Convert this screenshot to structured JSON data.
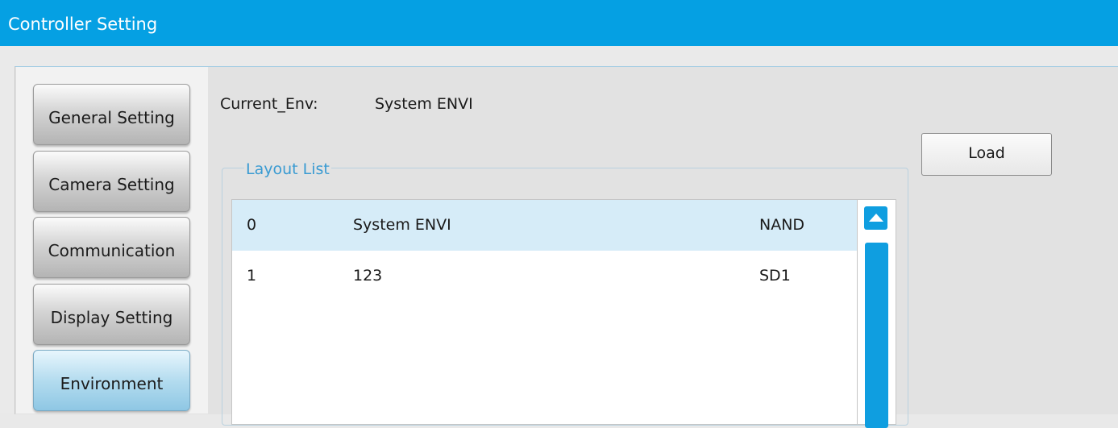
{
  "window": {
    "title": "Controller Setting"
  },
  "nav": {
    "items": [
      {
        "label": "General Setting"
      },
      {
        "label": "Camera Setting"
      },
      {
        "label": "Communication"
      },
      {
        "label": "Display Setting"
      },
      {
        "label": "Environment"
      }
    ],
    "active": "Environment"
  },
  "env": {
    "label": "Current_Env:",
    "value": "System ENVI"
  },
  "load_label": "Load",
  "layout_list": {
    "legend": "Layout List",
    "rows": [
      {
        "index": "0",
        "name": "System ENVI",
        "storage": "NAND",
        "selected": true
      },
      {
        "index": "1",
        "name": "123",
        "storage": "SD1",
        "selected": false
      }
    ]
  },
  "colors": {
    "title_bar": "#05a0e3",
    "accent": "#0f9ee0",
    "selected_row": "#d6ecf8"
  },
  "icons": {
    "scroll_up": "triangle-up-icon"
  }
}
